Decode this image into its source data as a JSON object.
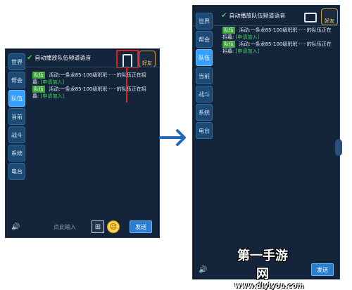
{
  "left_panel": {
    "auto_voice": "自动播放队伍频道语音",
    "tabs": [
      "世界",
      "帮会",
      "队伍",
      "当前",
      "战斗",
      "系统",
      "电台"
    ],
    "active_tab_index": 2,
    "friend_label": "好友",
    "messages": [
      {
        "badge": "队伍",
        "text": "活动:一条龙85-100级玳玳······的队伍正在招募:",
        "apply": "[申请加入]"
      },
      {
        "badge": "队伍",
        "text": "活动:一条龙85-100级玳玳······的队伍正在招募:",
        "apply": "[申请加入]"
      }
    ],
    "input_placeholder": "点此输入",
    "send_label": "发送"
  },
  "right_panel": {
    "auto_voice": "自动播放队伍频道语音",
    "tabs": [
      "世界",
      "帮会",
      "队伍",
      "当前",
      "战斗",
      "系统",
      "电台"
    ],
    "active_tab_index": 2,
    "friend_label": "好友",
    "messages": [
      {
        "badge": "队伍",
        "text": "活动:一条龙85-100级玳玳······的队伍正在招募:",
        "apply": "[申请加入]"
      },
      {
        "badge": "队伍",
        "text": "活动:一条龙85-100级玳玳······的队伍正在招募:",
        "apply": "[申请加入]"
      }
    ],
    "send_label": "发送"
  },
  "watermark": {
    "title": "第一手游网",
    "url": "www.dlyiyou.com"
  },
  "icons": [
    "check-icon",
    "phone-icon",
    "speaker-icon",
    "gift-icon",
    "emoji-icon",
    "arrow-right-icon"
  ]
}
